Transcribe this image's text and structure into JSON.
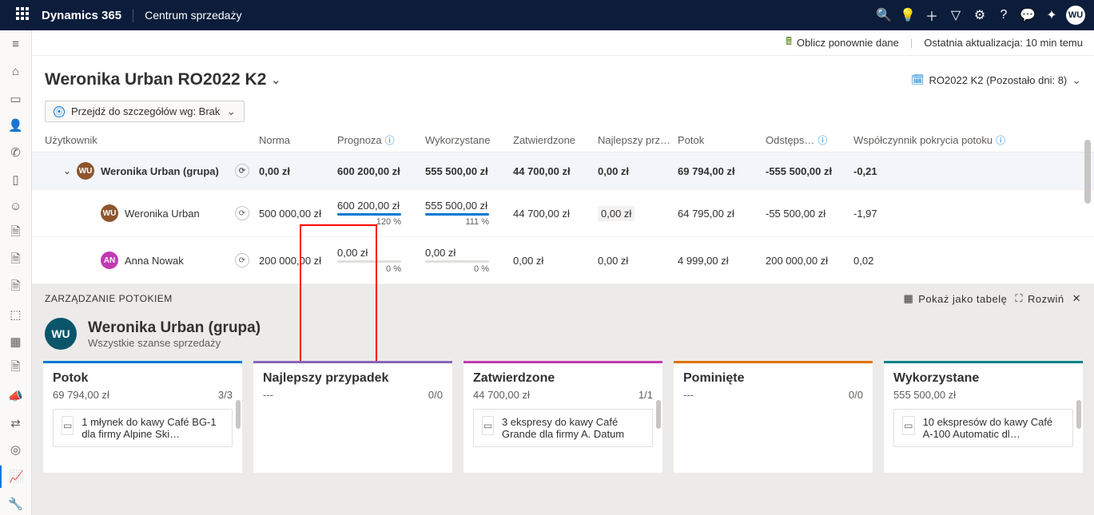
{
  "topbar": {
    "brand": "Dynamics 365",
    "area": "Centrum sprzedaży",
    "avatar": "WU"
  },
  "cmdbar": {
    "recalc": "Oblicz ponownie dane",
    "last_update": "Ostatnia aktualizacja: 10 min temu"
  },
  "title": {
    "name": "Weronika Urban RO2022 K2",
    "period_label": "RO2022 K2 (Pozostało dni: 8)"
  },
  "drill": {
    "label": "Przejdź do szczegółów wg: Brak"
  },
  "columns": {
    "user": "Użytkownik",
    "norma": "Norma",
    "prognoza": "Prognoza",
    "wykorzystane": "Wykorzystane",
    "zatwierdzone": "Zatwierdzone",
    "najlepszy": "Najlepszy prz…",
    "potok": "Potok",
    "odsteps": "Odstęps…",
    "wpp": "Współczynnik pokrycia potoku"
  },
  "rows": [
    {
      "type": "group",
      "name": "Weronika Urban (grupa)",
      "avatar": "WU",
      "avclass": "wu-av",
      "norma": "0,00 zł",
      "prognoza": "600 200,00 zł",
      "wykorzystane": "555 500,00 zł",
      "zatwierdzone": "44 700,00 zł",
      "najlepszy": "0,00 zł",
      "potok": "69 794,00 zł",
      "odsteps": "-555 500,00 zł",
      "wpp": "-0,21"
    },
    {
      "type": "child",
      "name": "Weronika Urban",
      "avatar": "WU",
      "avclass": "wu-av",
      "norma": "500 000,00 zł",
      "prognoza": "600 200,00 zł",
      "prognoza_pct": "120 %",
      "prognoza_fill": 100,
      "wykorzystane": "555 500,00 zł",
      "wyk_pct": "111 %",
      "wyk_fill": 100,
      "zatwierdzone": "44 700,00 zł",
      "najlepszy": "0,00 zł",
      "najlepszy_shaded": true,
      "potok": "64 795,00 zł",
      "odsteps": "-55 500,00 zł",
      "wpp": "-1,97"
    },
    {
      "type": "child",
      "name": "Anna Nowak",
      "avatar": "AN",
      "avclass": "an-av",
      "norma": "200 000,00 zł",
      "prognoza": "0,00 zł",
      "prognoza_pct": "0 %",
      "prognoza_fill": 0,
      "wykorzystane": "0,00 zł",
      "wyk_pct": "0 %",
      "wyk_fill": 0,
      "zatwierdzone": "0,00 zł",
      "najlepszy": "0,00 zł",
      "potok": "4 999,00 zł",
      "odsteps": "200 000,00 zł",
      "wpp": "0,02"
    }
  ],
  "panel": {
    "title": "ZARZĄDZANIE POTOKIEM",
    "table_btn": "Pokaż jako tabelę",
    "expand_btn": "Rozwiń",
    "group_name": "Weronika Urban (grupa)",
    "group_sub": "Wszystkie szanse sprzedaży",
    "avatar": "WU"
  },
  "kanban": [
    {
      "key": "potok",
      "title": "Potok",
      "amount": "69 794,00 zł",
      "count": "3/3",
      "card": "1 młynek do kawy Café BG-1 dla firmy Alpine Ski…"
    },
    {
      "key": "naj",
      "title": "Najlepszy przypadek",
      "amount": "---",
      "count": "0/0",
      "card": null
    },
    {
      "key": "zat",
      "title": "Zatwierdzone",
      "amount": "44 700,00 zł",
      "count": "1/1",
      "card": "3 ekspresy do kawy Café Grande dla firmy A. Datum"
    },
    {
      "key": "pom",
      "title": "Pominięte",
      "amount": "---",
      "count": "0/0",
      "card": null
    },
    {
      "key": "wyk",
      "title": "Wykorzystane",
      "amount": "555 500,00 zł",
      "count": "",
      "card": "10 ekspresów do kawy Café A-100 Automatic dl…"
    }
  ]
}
